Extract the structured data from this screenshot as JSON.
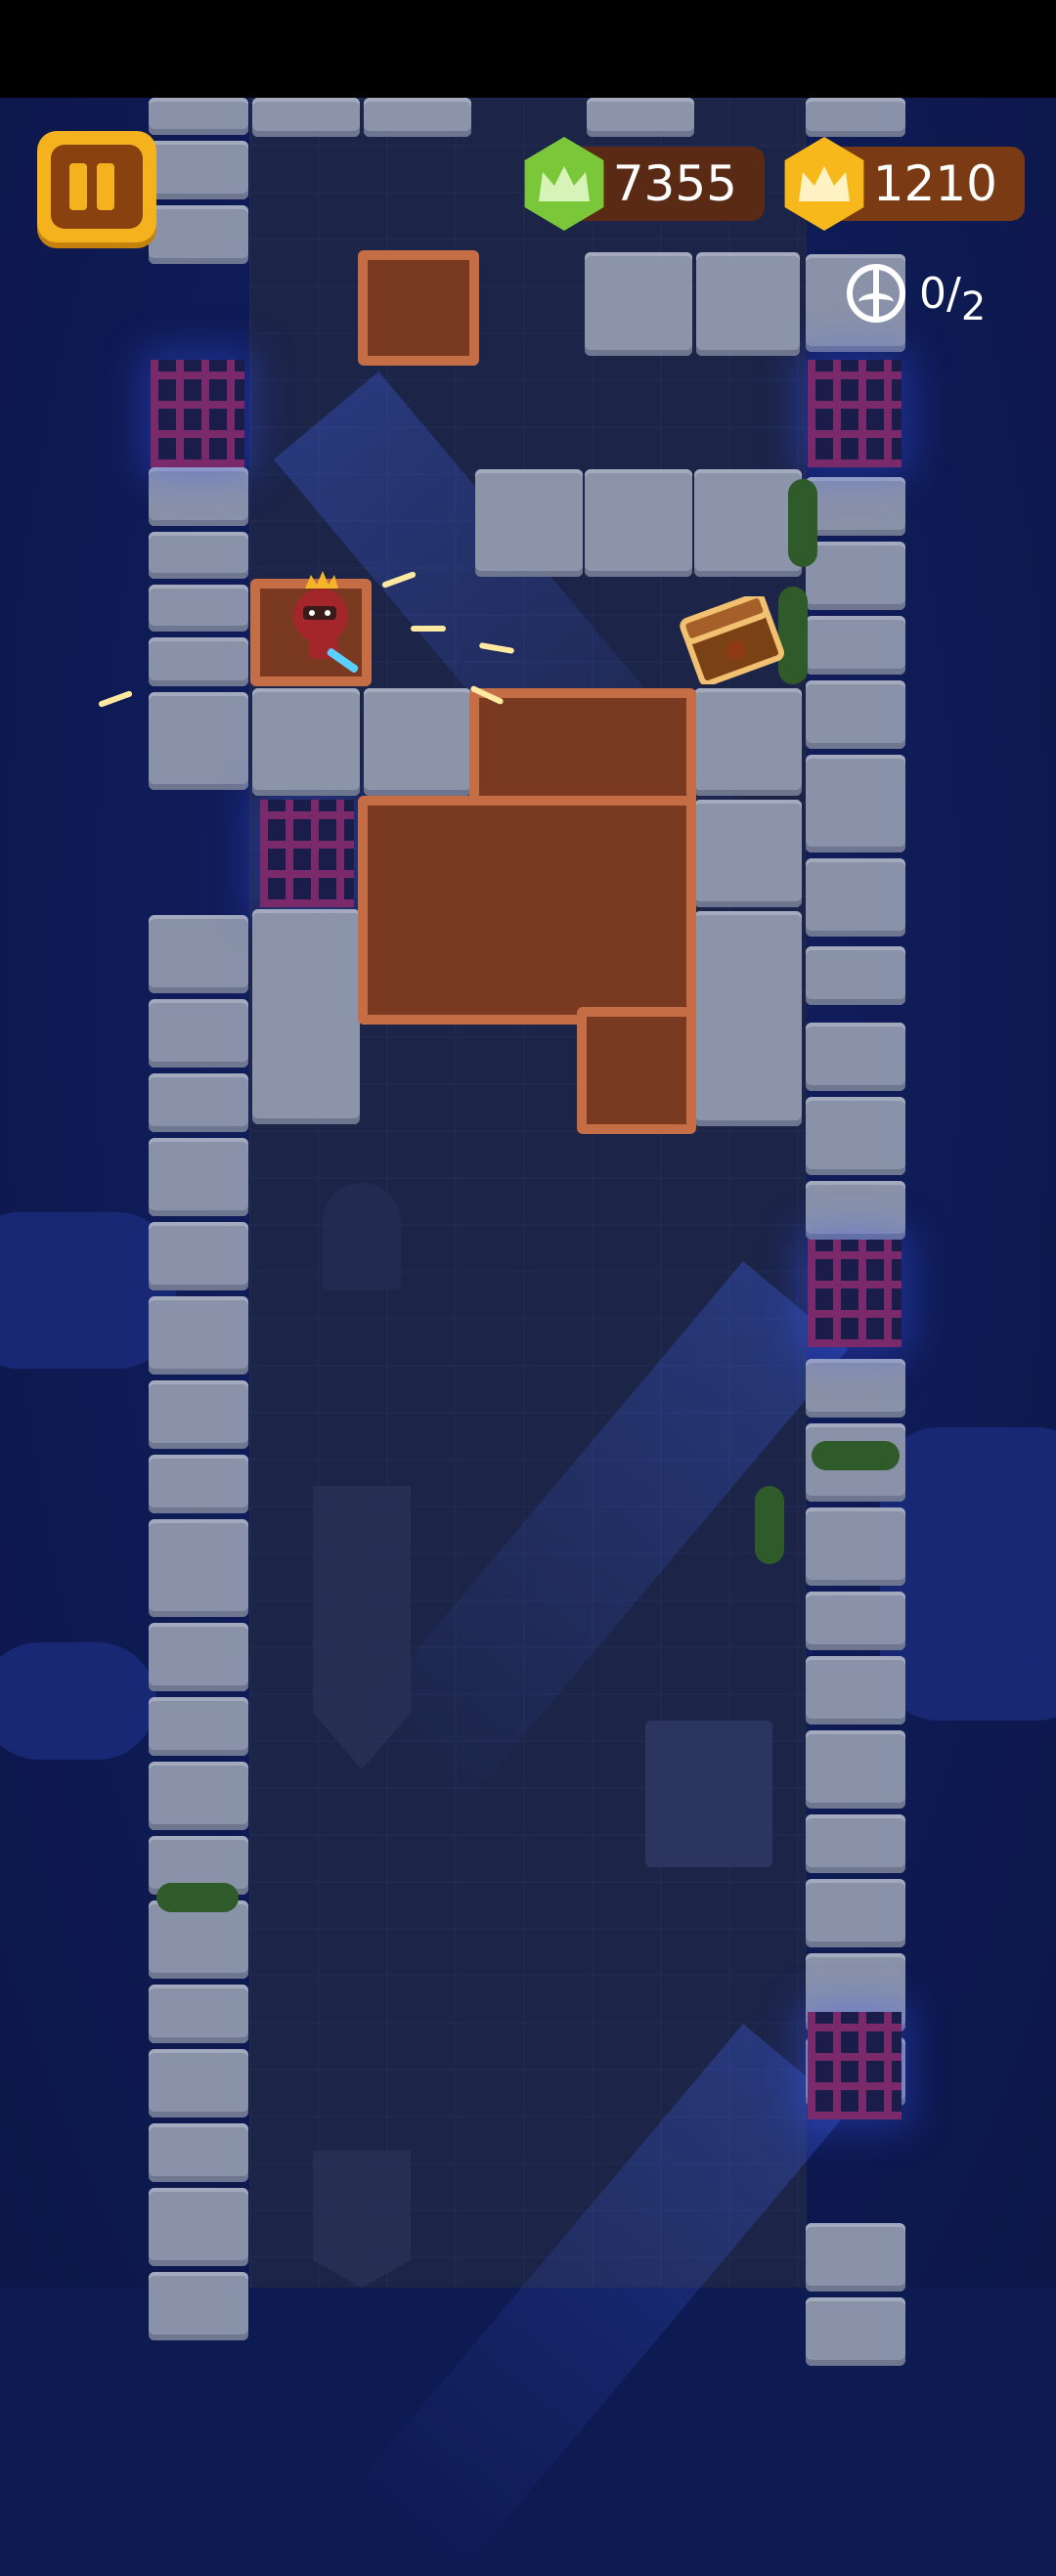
{
  "hud": {
    "pause_label": "",
    "green_crowns": "7355",
    "gold_crowns": "1210",
    "escapees_collected": "0",
    "escapees_total": "2"
  },
  "colors": {
    "pause": "#f4b21e",
    "green_crown": "#7ac83a",
    "gold_crown": "#f7b81c",
    "dirt": "#7a3a22",
    "stone": "#8c94aa",
    "sky": "#0e1a52"
  },
  "icons": [
    "pause-icon",
    "green-crown-icon",
    "gold-crown-icon",
    "peace-sign-icon",
    "treasure-chest-icon",
    "hero-king-icon"
  ]
}
